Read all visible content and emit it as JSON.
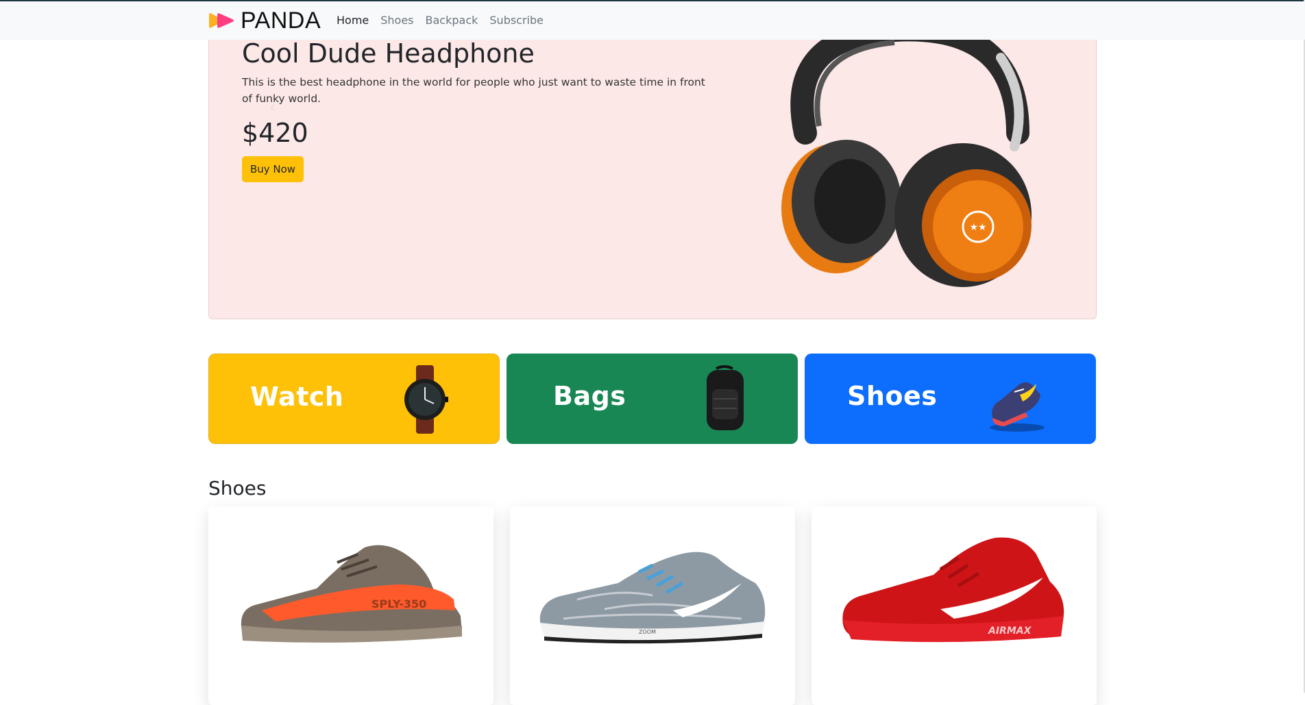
{
  "brand": {
    "name": "PANDA"
  },
  "nav": {
    "items": [
      {
        "label": "Home",
        "active": true
      },
      {
        "label": "Shoes",
        "active": false
      },
      {
        "label": "Backpack",
        "active": false
      },
      {
        "label": "Subscribe",
        "active": false
      }
    ]
  },
  "hero": {
    "title": "Cool Dude Headphone",
    "description": "This is the best headphone in the world for people who just want to waste time in front of funky world.",
    "price": "$420",
    "button_label": "Buy Now",
    "prev_icon": "chevron-left-icon",
    "next_icon": "chevron-right-icon",
    "image": "headphone-image",
    "background_color": "#fbe8e7",
    "button_color": "#ffc107"
  },
  "categories": [
    {
      "label": "Watch",
      "color": "#ffc107",
      "image": "watch-image"
    },
    {
      "label": "Bags",
      "color": "#198754",
      "image": "backpack-image"
    },
    {
      "label": "Shoes",
      "color": "#0d6efd",
      "image": "sneaker-image"
    }
  ],
  "shoes_section": {
    "title": "Shoes",
    "products": [
      {
        "image": "yeezy-sneaker-image",
        "print": "SPLY-350"
      },
      {
        "image": "nike-pegasus-sneaker-image",
        "print": "ZOOM"
      },
      {
        "image": "nike-airmax-red-sneaker-image",
        "print": "AIRMAX"
      }
    ]
  }
}
